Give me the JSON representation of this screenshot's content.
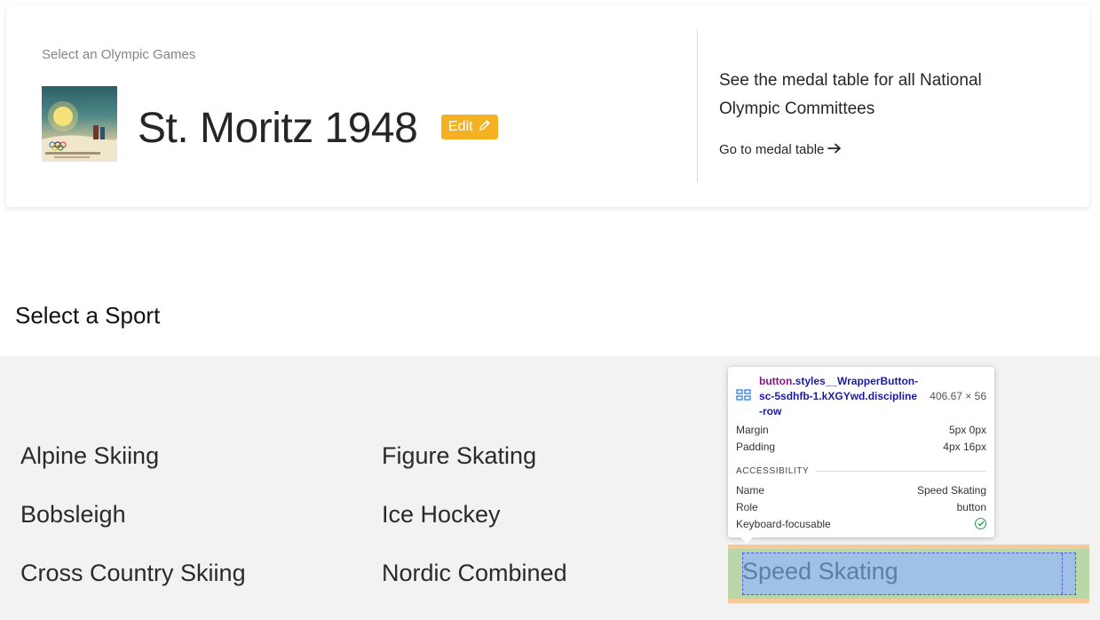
{
  "games": {
    "select_label": "Select an Olympic Games",
    "poster_alt": "Jeux Olympiques d'Hiver poster",
    "title": "St. Moritz 1948",
    "edit_label": "Edit",
    "medal_description": "See the medal table for all National Olympic Committees",
    "medal_link": "Go to medal table"
  },
  "sports": {
    "heading": "Select a Sport",
    "items": [
      "Alpine Skiing",
      "Figure Skating",
      "Bobsleigh",
      "Ice Hockey",
      "Cross Country Skiing",
      "Nordic Combined",
      "Speed Skating"
    ]
  },
  "devtools": {
    "selector_tag": "button",
    "selector_class": ".styles__WrapperButton-sc-5sdhfb-1.kXGYwd.discipline-row",
    "size": "406.67 × 56",
    "margin_label": "Margin",
    "margin_value": "5px 0px",
    "padding_label": "Padding",
    "padding_value": "4px 16px",
    "section": "ACCESSIBILITY",
    "name_label": "Name",
    "name_value": "Speed Skating",
    "role_label": "Role",
    "role_value": "button",
    "focus_label": "Keyboard-focusable"
  },
  "colors": {
    "edit_button": "#f4b223",
    "panel_bg": "#f2f2f2",
    "highlight_content": "#a0c1e6",
    "highlight_padding": "#b9d7a9",
    "highlight_margin": "#f6c48e"
  }
}
